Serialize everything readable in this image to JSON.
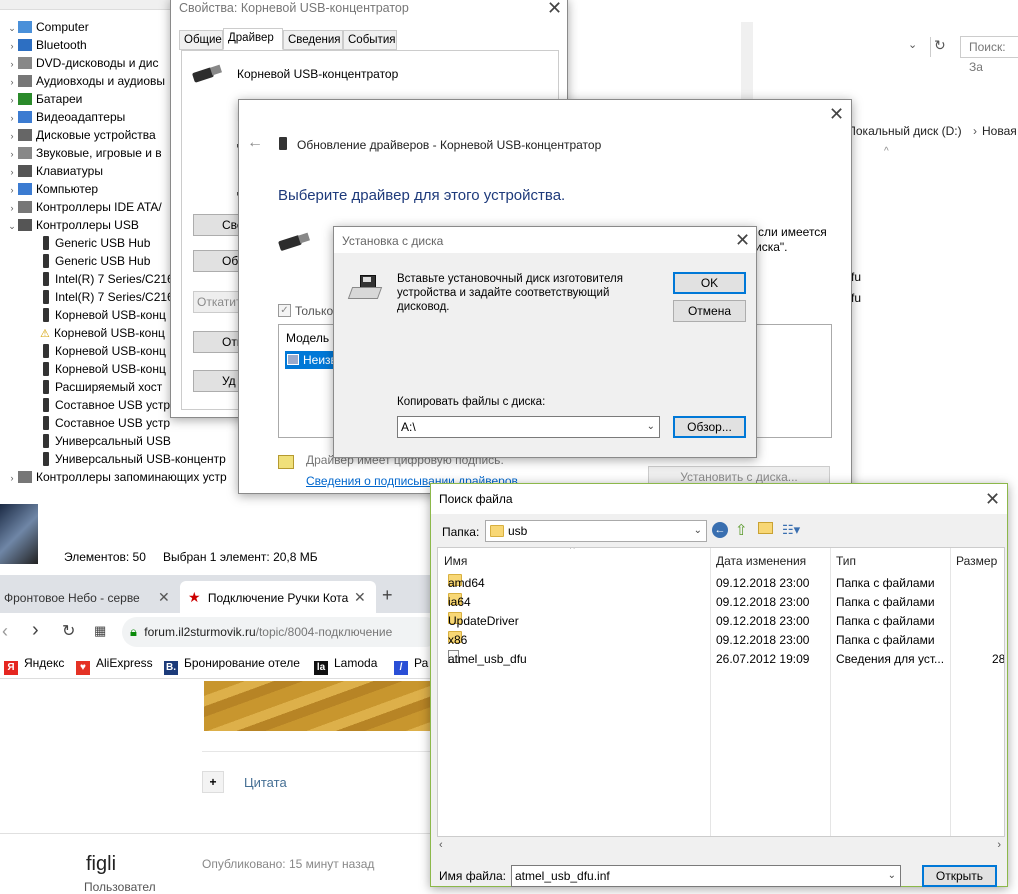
{
  "device_manager": {
    "root": "Computer",
    "categories": [
      "Bluetooth",
      "DVD-дисководы и дис",
      "Аудиовходы и аудиовы",
      "Батареи",
      "Видеоадаптеры",
      "Дисковые устройства",
      "Звуковые, игровые и в",
      "Клавиатуры",
      "Компьютер",
      "Контроллеры IDE ATA/",
      "Контроллеры USB"
    ],
    "usb_children": [
      "Generic USB Hub",
      "Generic USB Hub",
      "Intel(R) 7 Series/C216",
      "Intel(R) 7 Series/C216",
      "Корневой USB-конц",
      "Корневой USB-конц",
      "Корневой USB-конц",
      "Корневой USB-конц",
      "Расширяемый хост",
      "Составное USB устр",
      "Составное USB устр",
      "Универсальный USB",
      "Универсальный USB-концентр"
    ],
    "last_category": "Контроллеры запоминающих устр"
  },
  "props_dialog": {
    "title": "Свойства: Корневой USB-концентратор",
    "tabs": [
      "Общие",
      "Драйвер",
      "Сведения",
      "События"
    ],
    "device_name": "Корневой USB-концентратор",
    "btn_labels": [
      "Све",
      "Обн",
      "Откатит",
      "Отк",
      "Уд"
    ]
  },
  "update_dialog": {
    "title": "Обновление драйверов - Корневой USB-концентратор",
    "heading": "Выберите драйвер для этого устройства.",
    "side_text_1": "сли имеется",
    "side_text_2": "иска\".",
    "checkbox_label": "Только",
    "list_header": "Модель",
    "list_item": "Неизв",
    "signed_text": "Драйвер имеет цифровую подпись.",
    "signing_link": "Сведения о подписывании драйверов",
    "install_button": "Установить с диска..."
  },
  "install_disk": {
    "title": "Установка с диска",
    "message": "Вставьте установочный диск изготовителя устройства и задайте соответствующий дисковод.",
    "ok": "OK",
    "cancel": "Отмена",
    "copy_label": "Копировать файлы с диска:",
    "copy_value": "A:\\",
    "browse": "Обзор..."
  },
  "explorer": {
    "search_placeholder": "Поиск: За",
    "path_local": "Локальный диск (D:)",
    "path_new": "Новая",
    "bg_right_1": "r",
    "bg_right_2": "fu",
    "bg_right_3": "fu",
    "status_items": "Элементов: 50",
    "status_selected": "Выбран 1 элемент: 20,8 МБ"
  },
  "browser": {
    "tab1": "Фронтовое Небо - серве",
    "tab2": "Подключение Ручки Кота",
    "new_tab": "+",
    "url_domain": "forum.il2sturmovik.ru",
    "url_path": "/topic/8004-подключение",
    "bookmarks": [
      {
        "label": "Яндекс",
        "icon": "yandex-icon",
        "color": "#e52620"
      },
      {
        "label": "AliExpress",
        "icon": "aliexpress-icon",
        "color": "#e43225"
      },
      {
        "label": "Бронирование отеле",
        "icon": "booking-icon",
        "color": "#1c3b7a"
      },
      {
        "label": "Lamoda",
        "icon": "lamoda-icon",
        "color": "#111111"
      },
      {
        "label": "Ра",
        "icon": "bookmark-icon",
        "color": "#2a4fd6"
      }
    ],
    "quote_label": "Цитата",
    "user_name": "figli",
    "user_role": "Пользовател",
    "published": "Опубликовано: 15 минут назад"
  },
  "file_dialog": {
    "title": "Поиск файла",
    "folder_label": "Папка:",
    "folder_value": "usb",
    "columns": [
      "Имя",
      "Дата изменения",
      "Тип",
      "Размер"
    ],
    "rows": [
      {
        "name": "amd64",
        "date": "09.12.2018 23:00",
        "type": "Папка с файлами",
        "size": "",
        "kind": "folder"
      },
      {
        "name": "ia64",
        "date": "09.12.2018 23:00",
        "type": "Папка с файлами",
        "size": "",
        "kind": "folder"
      },
      {
        "name": "UpdateDriver",
        "date": "09.12.2018 23:00",
        "type": "Папка с файлами",
        "size": "",
        "kind": "folder"
      },
      {
        "name": "x86",
        "date": "09.12.2018 23:00",
        "type": "Папка с файлами",
        "size": "",
        "kind": "folder"
      },
      {
        "name": "atmel_usb_dfu",
        "date": "26.07.2012 19:09",
        "type": "Сведения для уст...",
        "size": "28",
        "kind": "file"
      }
    ],
    "filename_label": "Имя файла:",
    "filename_value": "atmel_usb_dfu.inf",
    "open_button": "Открыть"
  }
}
